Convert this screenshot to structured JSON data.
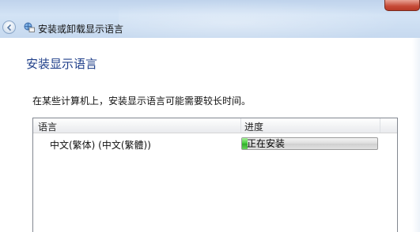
{
  "window": {
    "title": "安装或卸载显示语言",
    "back_icon": "back-arrow-icon",
    "app_icon": "language-globe-icon",
    "close_icon": "close-icon"
  },
  "page": {
    "heading": "安装显示语言",
    "description": "在某些计算机上，安装显示语言可能需要较长时间。"
  },
  "list": {
    "columns": [
      "语言",
      "进度"
    ],
    "rows": [
      {
        "language": "中文(繁体) (中文(繁體))",
        "status": "正在安装",
        "progress_fraction": 0.04
      }
    ]
  },
  "colors": {
    "heading": "#1f3f8a",
    "progress_green": "#3fc736",
    "close_red": "#c64a37"
  }
}
